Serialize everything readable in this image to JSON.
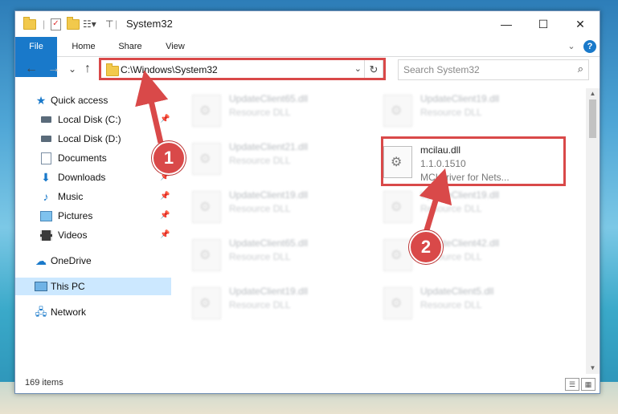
{
  "title": "System32",
  "ribbon": {
    "tabs": [
      "File",
      "Home",
      "Share",
      "View"
    ],
    "help": "?"
  },
  "window_controls": {
    "minimize": "—",
    "maximize": "☐",
    "close": "✕"
  },
  "nav": {
    "back": "←",
    "forward": "→",
    "recent": "⌄",
    "up": "↑"
  },
  "address": {
    "path": "C:\\Windows\\System32",
    "dropdown": "⌄",
    "refresh": "↻"
  },
  "search": {
    "placeholder": "Search System32",
    "icon": "⌕"
  },
  "sidebar": {
    "items": [
      {
        "label": "Quick access",
        "icon": "star-icon"
      },
      {
        "label": "Local Disk (C:)",
        "icon": "drive-icon"
      },
      {
        "label": "Local Disk (D:)",
        "icon": "drive-icon"
      },
      {
        "label": "Documents",
        "icon": "document-icon"
      },
      {
        "label": "Downloads",
        "icon": "download-icon"
      },
      {
        "label": "Music",
        "icon": "music-icon"
      },
      {
        "label": "Pictures",
        "icon": "pictures-icon"
      },
      {
        "label": "Videos",
        "icon": "videos-icon"
      },
      {
        "label": "OneDrive",
        "icon": "cloud-icon"
      },
      {
        "label": "This PC",
        "icon": "pc-icon"
      },
      {
        "label": "Network",
        "icon": "network-icon"
      }
    ],
    "pin": "📌"
  },
  "files": {
    "left": [
      {
        "name": "UpdateClient65.dll",
        "desc": "Resource DLL"
      },
      {
        "name": "UpdateClient21.dll",
        "desc": "Resource DLL"
      },
      {
        "name": "UpdateClient19.dll",
        "desc": "Resource DLL"
      },
      {
        "name": "UpdateClient65.dll",
        "desc": "Resource DLL"
      },
      {
        "name": "UpdateClient19.dll",
        "desc": "Resource DLL"
      }
    ],
    "right": [
      {
        "name": "UpdateClient19.dll",
        "desc": "Resource DLL"
      },
      {
        "name": "UpdateClient19.dll",
        "desc": "Resource DLL"
      },
      {
        "name": "UpdateClient42.dll",
        "desc": "Resource DLL"
      },
      {
        "name": "UpdateClient5.dll",
        "desc": "Resource DLL"
      }
    ],
    "highlighted": {
      "name": "mcilau.dll",
      "version": "1.1.0.1510",
      "desc": "MCI driver for Nets..."
    }
  },
  "status": {
    "count": "169 items",
    "details_view": "☰",
    "tiles_view": "▦"
  },
  "annotations": {
    "step1": "1",
    "step2": "2",
    "color": "#d94949"
  }
}
